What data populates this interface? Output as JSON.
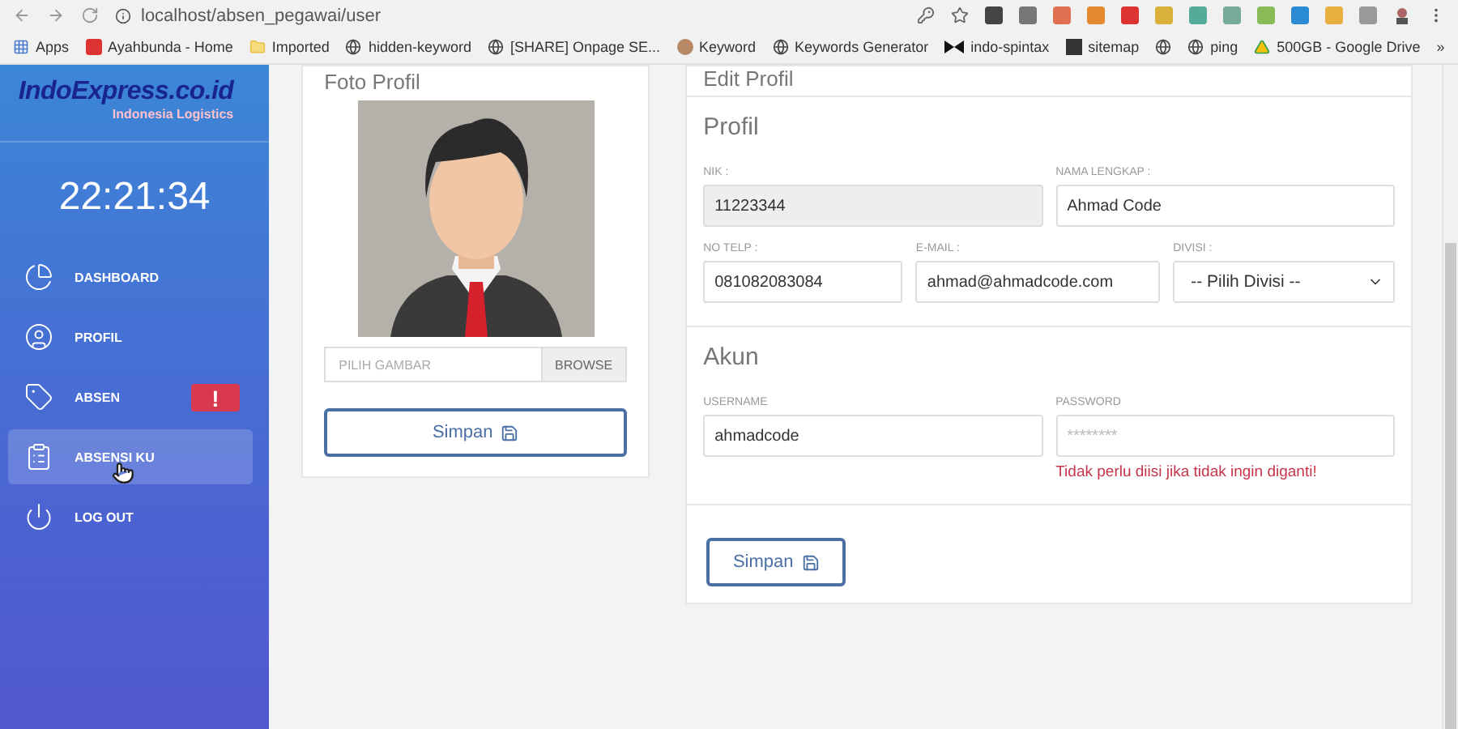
{
  "browser": {
    "url": "localhost/absen_pegawai/user",
    "bookmarks": [
      {
        "kind": "apps",
        "label": "Apps"
      },
      {
        "kind": "brand",
        "label": "Ayahbunda - Home"
      },
      {
        "kind": "folder",
        "label": "Imported"
      },
      {
        "kind": "globe",
        "label": "hidden-keyword"
      },
      {
        "kind": "globe",
        "label": "[SHARE] Onpage SE..."
      },
      {
        "kind": "avatar",
        "label": "Keyword"
      },
      {
        "kind": "globe",
        "label": "Keywords Generator"
      },
      {
        "kind": "bow",
        "label": "indo-spintax"
      },
      {
        "kind": "square",
        "label": "sitemap"
      },
      {
        "kind": "globe"
      },
      {
        "kind": "globe",
        "label": "ping"
      },
      {
        "kind": "drive",
        "label": "500GB - Google Drive"
      },
      {
        "kind": "more",
        "label": "»"
      }
    ]
  },
  "sidebar": {
    "logo": "IndoExpress.co.id",
    "tagline": "Indonesia Logistics",
    "clock": "22:21:34",
    "items": [
      {
        "kind": "pie",
        "label": "DASHBOARD",
        "selected": false
      },
      {
        "kind": "user",
        "label": "PROFIL",
        "selected": false
      },
      {
        "kind": "tag",
        "label": "ABSEN",
        "selected": false,
        "badge": "!"
      },
      {
        "kind": "clipboard",
        "label": "ABSENSI KU",
        "selected": true
      },
      {
        "kind": "power",
        "label": "LOG OUT",
        "selected": false
      }
    ]
  },
  "photo_card": {
    "title": "Foto Profil",
    "file_placeholder": "PILIH GAMBAR",
    "browse_button": "BROWSE",
    "save_button": "Simpan"
  },
  "edit_card": {
    "title": "Edit Profil",
    "sections": [
      {
        "title": "Profil",
        "rows": [
          [
            {
              "kind": "text",
              "label": "NIK :",
              "value": "11223344",
              "disabled": true
            },
            {
              "kind": "text",
              "label": "NAMA LENGKAP :",
              "value": "Ahmad Code",
              "disabled": false
            }
          ],
          [
            {
              "kind": "text",
              "label": "NO TELP :",
              "value": "081082083084",
              "disabled": false
            },
            {
              "kind": "text",
              "label": "E-MAIL :",
              "value": "ahmad@ahmadcode.com",
              "disabled": false
            },
            {
              "kind": "select",
              "label": "DIVISI :",
              "value": "-- Pilih Divisi --",
              "disabled": false
            }
          ]
        ]
      },
      {
        "title": "Akun",
        "rows": [
          [
            {
              "kind": "text",
              "label": "USERNAME",
              "value": "ahmadcode",
              "disabled": false
            },
            {
              "kind": "password",
              "label": "PASSWORD",
              "placeholder": "********",
              "hint": "Tidak perlu diisi jika tidak ingin diganti!",
              "disabled": false
            }
          ]
        ]
      }
    ],
    "save_button": "Simpan"
  }
}
